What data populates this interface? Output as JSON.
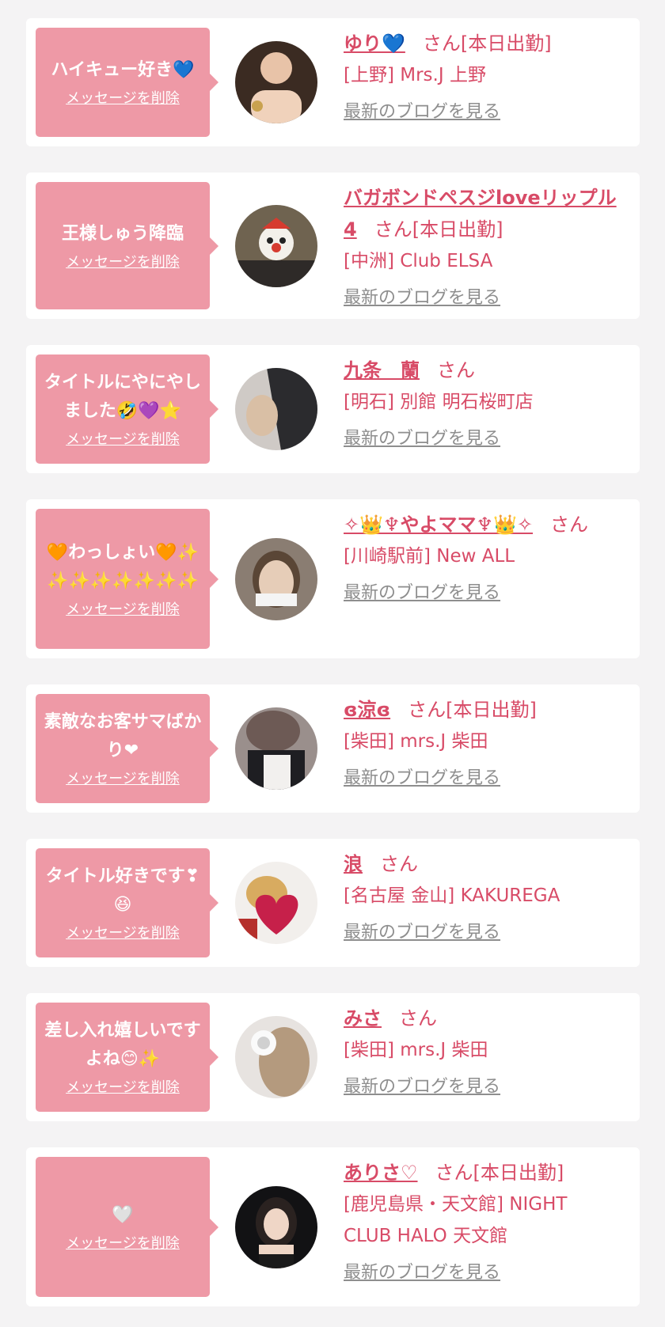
{
  "delete_label": "メッセージを削除",
  "blog_label": "最新のブログを見る",
  "san_label": "さん",
  "colors": {
    "accent": "#d84b67",
    "bubble": "#ee99a6",
    "link_gray": "#8e8e8e",
    "background": "#f4f3f4"
  },
  "cards": [
    {
      "title": "ハイキュー好き💙",
      "name": "ゆり💙",
      "san": "さん[本日出勤]",
      "shop": "[上野] Mrs.J 上野",
      "avatar": "avatar-photo-1"
    },
    {
      "title": "王様しゅう降臨",
      "name": "バガボンドペスジloveリップル4",
      "san": "さん[本日出勤]",
      "shop": "[中洲] Club ELSA",
      "avatar": "avatar-photo-2"
    },
    {
      "title": "タイトルにやにやしました🤣💜⭐",
      "name": "九条　蘭",
      "san": "さん",
      "shop": "[明石] 別館 明石桜町店",
      "avatar": "avatar-photo-3"
    },
    {
      "title": "🧡わっしょい🧡✨✨✨✨✨✨✨✨",
      "name": "✧👑♆やよママ♆👑✧",
      "san": "さん",
      "shop": "[川崎駅前] New ALL",
      "avatar": "avatar-photo-4"
    },
    {
      "title": "素敵なお客サマばかり❤",
      "name": "ɞ涼ɞ",
      "san": "さん[本日出勤]",
      "shop": "[柴田] mrs.J 柴田",
      "avatar": "avatar-photo-5"
    },
    {
      "title": "タイトル好きです❣😆",
      "name": "浪",
      "san": "さん",
      "shop": "[名古屋 金山] KAKUREGA",
      "avatar": "avatar-photo-6"
    },
    {
      "title": "差し入れ嬉しいですよね😊✨",
      "name": "みさ",
      "san": "さん",
      "shop": "[柴田] mrs.J 柴田",
      "avatar": "avatar-photo-7"
    },
    {
      "title": "🤍",
      "name": "ありさ♡",
      "san": "さん[本日出勤]",
      "shop": "[鹿児島県・天文館] NIGHT CLUB HALO 天文館",
      "avatar": "avatar-photo-8"
    }
  ]
}
